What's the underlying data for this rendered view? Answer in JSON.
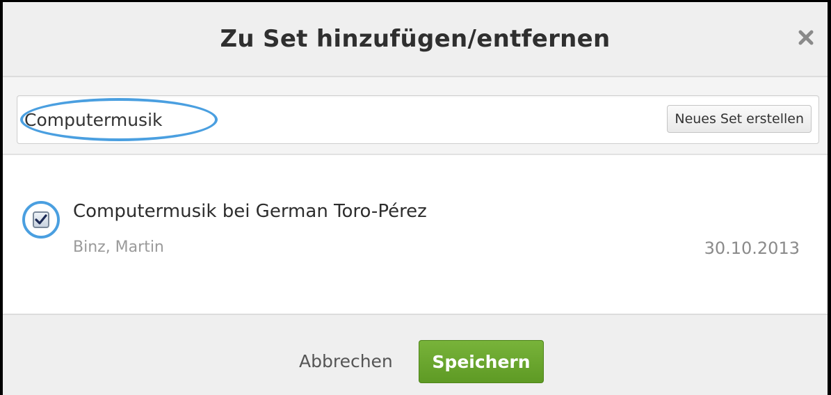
{
  "dialog": {
    "title": "Zu Set hinzufügen/entfernen",
    "close_icon": "close-icon"
  },
  "search": {
    "value": "Computermusik",
    "new_set_label": "Neues Set erstellen"
  },
  "results": [
    {
      "checked": true,
      "title": "Computermusik bei German Toro-Pérez",
      "author": "Binz, Martin",
      "date": "30.10.2013"
    }
  ],
  "footer": {
    "cancel_label": "Abbrechen",
    "save_label": "Speichern"
  },
  "colors": {
    "accent_highlight": "#4a9fe0",
    "save_button": "#6aa82e"
  }
}
